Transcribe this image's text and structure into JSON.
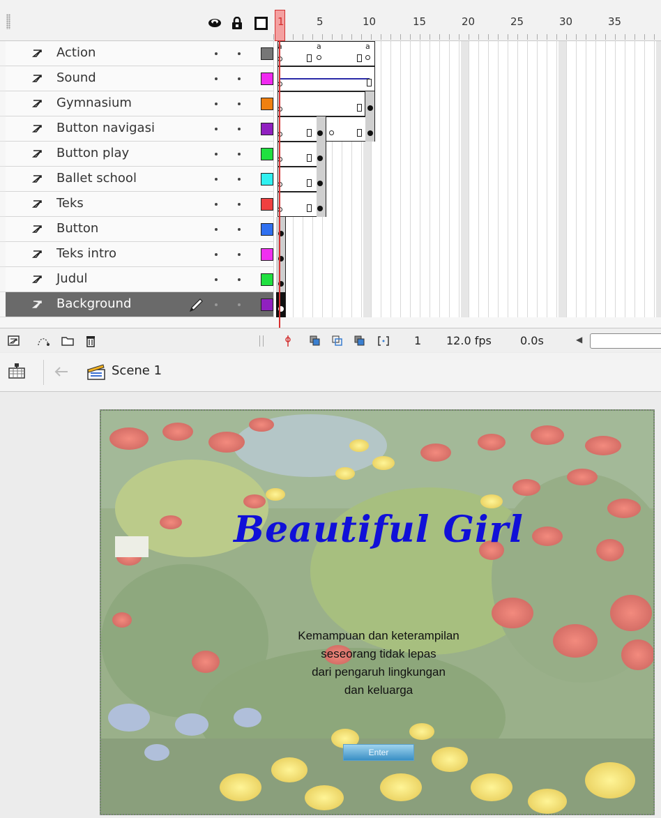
{
  "timeline": {
    "ruler_numbers": [
      "1",
      "5",
      "10",
      "15",
      "20",
      "25",
      "30",
      "35"
    ],
    "header_icons": [
      "eye-icon",
      "lock-icon",
      "outline-icon"
    ],
    "layers": [
      {
        "name": "Action",
        "color": "#777777"
      },
      {
        "name": "Sound",
        "color": "#f02af0"
      },
      {
        "name": "Gymnasium",
        "color": "#f08010"
      },
      {
        "name": "Button navigasi",
        "color": "#9020c0"
      },
      {
        "name": "Button play",
        "color": "#20e040"
      },
      {
        "name": "Ballet school",
        "color": "#30f0f0"
      },
      {
        "name": "Teks",
        "color": "#f04040"
      },
      {
        "name": "Button",
        "color": "#3070f0"
      },
      {
        "name": "Teks intro",
        "color": "#f030f0"
      },
      {
        "name": "Judul",
        "color": "#20e040"
      },
      {
        "name": "Background",
        "color": "#9020c0",
        "selected": true
      }
    ],
    "footer": {
      "current_frame": "1",
      "fps": "12.0 fps",
      "elapsed": "0.0s"
    }
  },
  "editbar": {
    "scene_label": "Scene 1"
  },
  "stage": {
    "title": "Beautiful Girl",
    "intro_lines": [
      "Kemampuan dan keterampilan",
      "seseorang tidak lepas",
      "dari pengaruh lingkungan",
      "dan keluarga"
    ],
    "enter_button": "Enter"
  }
}
